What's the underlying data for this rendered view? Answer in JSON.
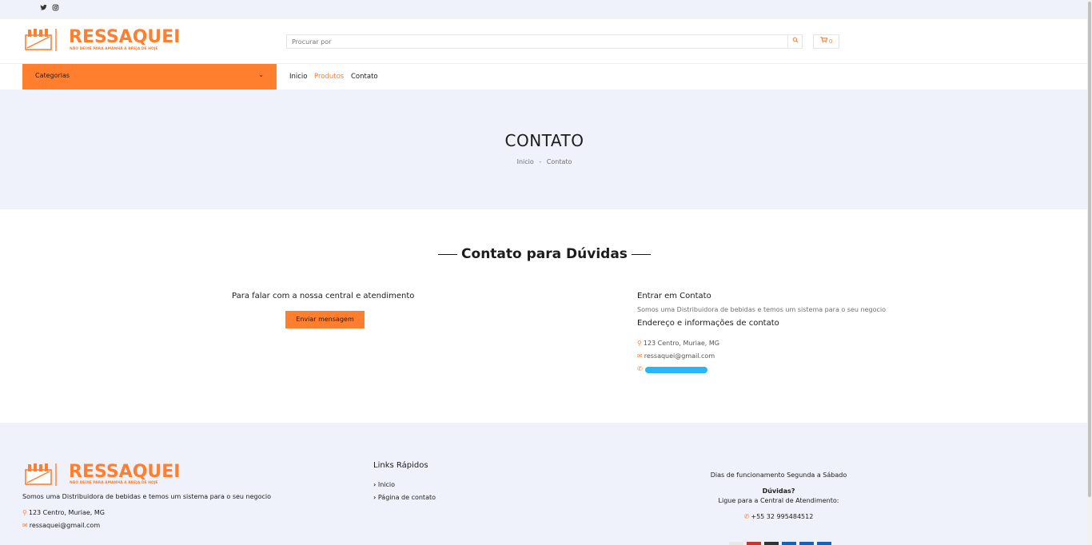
{
  "topbar": {
    "twitter_icon": "twitter-icon",
    "instagram_icon": "instagram-icon"
  },
  "header": {
    "logo_text": "RESSAQUEI",
    "logo_tagline": "NÃO DEIXE PARA AMANHÃ A BREJA DE HOJE",
    "search_placeholder": "Procurar por",
    "cart_count": "0"
  },
  "categories": {
    "label": "Categorias"
  },
  "nav": {
    "items": [
      "Inicio",
      "Produtos",
      "Contato"
    ]
  },
  "hero": {
    "title": "CONTATO",
    "breadcrumb_home": "Inicio",
    "breadcrumb_sep": "-",
    "breadcrumb_current": "Contato"
  },
  "contact": {
    "section_title": "Contato para Dúvidas",
    "left_title": "Para falar com a nossa central e atendimento",
    "send_button": "Enviar mensagem",
    "right_title": "Entrar em Contato",
    "right_desc": "Somos uma Distribuidora de bebidas e temos um sistema para o seu negocio",
    "address_title": "Endereço e informações de contato",
    "address": "123 Centro, Muriae, MG",
    "email": "ressaquei@gmail.com"
  },
  "footer": {
    "description": "Somos uma Distribuidora de bebidas e temos um sistema para o seu negocio",
    "address": "123 Centro, Muriae, MG",
    "email": "ressaquei@gmail.com",
    "links_title": "Links Rápidos",
    "link_home": "Inicio",
    "link_contact": "Página de contato",
    "hours": "Dias de funcionamento Segunda a Sábado",
    "doubts": "Dúvidas?",
    "call_text": "Ligue para a Central de Atendimento:",
    "phone": "+55 32 995484512"
  },
  "colors": {
    "accent": "#ff7f2f",
    "band": "#eff1fb",
    "redact": "#29b6f6"
  }
}
